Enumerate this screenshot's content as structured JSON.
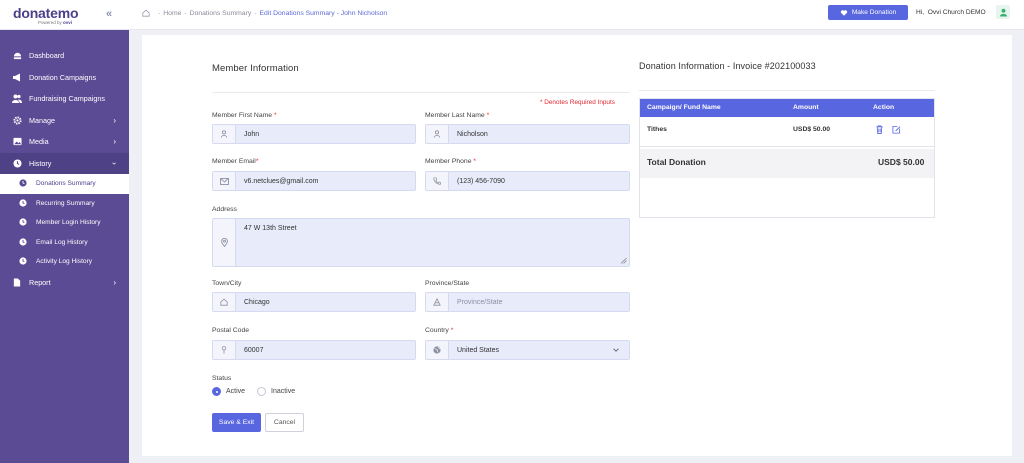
{
  "brand": {
    "name": "donatemo",
    "powered_by": "Powered by",
    "powered_brand": "ovvi"
  },
  "sidebar": {
    "items": [
      {
        "label": "Dashboard",
        "icon": "dashboard-icon"
      },
      {
        "label": "Donation Campaigns",
        "icon": "megaphone-icon"
      },
      {
        "label": "Fundraising Campaigns",
        "icon": "people-icon"
      },
      {
        "label": "Manage",
        "icon": "gear-icon"
      },
      {
        "label": "Media",
        "icon": "image-icon"
      },
      {
        "label": "History",
        "icon": "clock-icon"
      }
    ],
    "history_sub": [
      {
        "label": "Donations Summary"
      },
      {
        "label": "Recurring Summary"
      },
      {
        "label": "Member Login History"
      },
      {
        "label": "Email Log History"
      },
      {
        "label": "Activity Log History"
      }
    ],
    "report": {
      "label": "Report",
      "icon": "document-icon"
    }
  },
  "breadcrumb": {
    "home": "Home",
    "parent": "Donations Summary",
    "current": "Edit Donations Summary - John Nicholson",
    "separator": "-"
  },
  "topbar": {
    "make_donation": "Make Donation",
    "greeting": "Hi,",
    "user": "Ovvi Church DEMO"
  },
  "member": {
    "title": "Member Information",
    "required_note": "* Denotes Required Inputs",
    "first_name": {
      "label": "Member First Name",
      "required": "*",
      "value": "John"
    },
    "last_name": {
      "label": "Member Last Name",
      "required": "*",
      "value": "Nicholson"
    },
    "email": {
      "label": "Member Email",
      "required": "*",
      "value": "v6.netclues@gmail.com"
    },
    "phone": {
      "label": "Member Phone",
      "required": "*",
      "value": "(123) 456-7090"
    },
    "address": {
      "label": "Address",
      "value": "47 W 13th Street"
    },
    "city": {
      "label": "Town/City",
      "value": "Chicago"
    },
    "province": {
      "label": "Province/State",
      "placeholder": "Province/State"
    },
    "postal": {
      "label": "Postal Code",
      "value": "60007"
    },
    "country": {
      "label": "Country",
      "required": "*",
      "value": "United States"
    },
    "status": {
      "label": "Status",
      "options": [
        "Active",
        "Inactive"
      ],
      "selected": "Active"
    },
    "save_label": "Save & Exit",
    "cancel_label": "Cancel"
  },
  "donation": {
    "title": "Donation Information - Invoice #202100033",
    "columns": [
      "Campaign/ Fund Name",
      "Amount",
      "Action"
    ],
    "rows": [
      {
        "campaign": "Tithes",
        "amount": "USD$ 50.00"
      }
    ],
    "total_label": "Total Donation",
    "total_value": "USD$ 50.00"
  },
  "colors": {
    "sidebar": "#5b4b94",
    "accent": "#5866e0",
    "required": "#e0282e",
    "field_bg": "#e8ebfa"
  }
}
